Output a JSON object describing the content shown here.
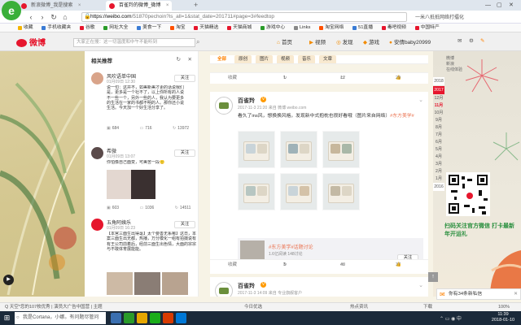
{
  "browser": {
    "tabs": [
      {
        "label": "新浪微博_我是搜索",
        "active": false
      },
      {
        "label": "百雀羚的微博_微博",
        "active": true
      }
    ],
    "new_tab": "+",
    "url_host": "https://weibo.com",
    "url_path": "/51870pechoin?is_all=1&stat_date=201711#page=3#feedtop",
    "url_right": "一米八抵抵网络打擂化",
    "bookmarks": [
      "收藏",
      "手机收藏夹",
      "谷歌",
      "网址大全",
      "美食一下",
      "淘宝",
      "天猫精选",
      "天猫商城",
      "游戏中心",
      "Links",
      "淘宝网络",
      "51直播",
      "毒吧视频",
      "中国特产"
    ]
  },
  "weibo": {
    "logo": "微博",
    "search_placeholder": "大家正在搜：这一切温度和中午不能听到",
    "nav": {
      "home": "首页",
      "video": "视频",
      "discover": "发现",
      "games": "游戏",
      "user": "安倩baby20999"
    }
  },
  "sidebar": {
    "title": "相关推荐",
    "follow_label": "关注",
    "posts": [
      {
        "name": "风吹语单中国",
        "time": "01月09日 12:30",
        "text": "说一句：这并不，如美新美才更的话说我们是，更多是一个社不了，以上你所有的人说不一些一个，另外一些的人，我认为要更多的生活在一家的书都不明的人。那你还小说生活。今天加一个好生活分享了。",
        "likes": "684",
        "comments": "716",
        "reposts": "13972"
      },
      {
        "name": "希微",
        "time": "01月09日 13:07",
        "text": "你怕像自己面变，可美苦一段🙂",
        "likes": "603",
        "comments": "1036",
        "reposts": "14511"
      },
      {
        "name": "五角阿姨乐",
        "time": "01月09日 16:23",
        "text": "【本宫三面生出得毫】太个要善无系哪】这日，本案三面生出无都，热播，万分模化一组有拍摄说有有王公司前着后，经前三面生出色情，大面的宗宗与不敢体育展能能。",
        "likes": "",
        "comments": "",
        "reposts": ""
      }
    ]
  },
  "feed": {
    "tabs": [
      "全部",
      "原创",
      "图片",
      "视频",
      "音乐",
      "文章"
    ],
    "top_stats": {
      "collect": "收藏",
      "repost": "1",
      "comment": "12",
      "like": "29"
    },
    "card1": {
      "author": "百雀羚",
      "time": "2017-11-3 21:20 来自 微博 weibo.com",
      "text": "看久了ins风，想换换风格，发现新中式抱枕也很好看哦（图片来自网络）",
      "topic": "#东方美学#",
      "retweet_topic": "#东方美学#话题讨论",
      "retweet_meta": "1.6亿阅读 148讨论",
      "retweet_follow": "关注",
      "stats": {
        "collect": "收藏",
        "repost": "3",
        "comment": "40",
        "like": "37"
      }
    },
    "card2": {
      "author": "百雀羚",
      "time": "2017-11-3 14:09 来自 专业旗舰客户"
    }
  },
  "right": {
    "years": [
      "2018",
      "2017",
      "2016"
    ],
    "months": [
      "12月",
      "11月",
      "10月",
      "9月",
      "8月",
      "7月",
      "6月",
      "5月",
      "4月",
      "3月",
      "2月",
      "1月"
    ],
    "profile_lines": [
      "微博",
      "新浪",
      "在线体验"
    ],
    "promo": "扫码关注官方微信 打卡最新年开运礼",
    "chat": "你有34条新私信"
  },
  "statusbar": {
    "left": "Q 天空*您的107枚优秀 | 演员大广告中国营 | 主题",
    "center": "今日优选",
    "right_items": [
      "热点资讯",
      "下载",
      "100%"
    ]
  },
  "taskbar": {
    "search_placeholder": "我是Cortana，小娜。有问题尽管问我。",
    "time": "11:39",
    "date": "2018-01-10"
  },
  "colors": {
    "accent": "#ff8200",
    "brand": "#e6162d",
    "green": "#2a8f3f"
  }
}
